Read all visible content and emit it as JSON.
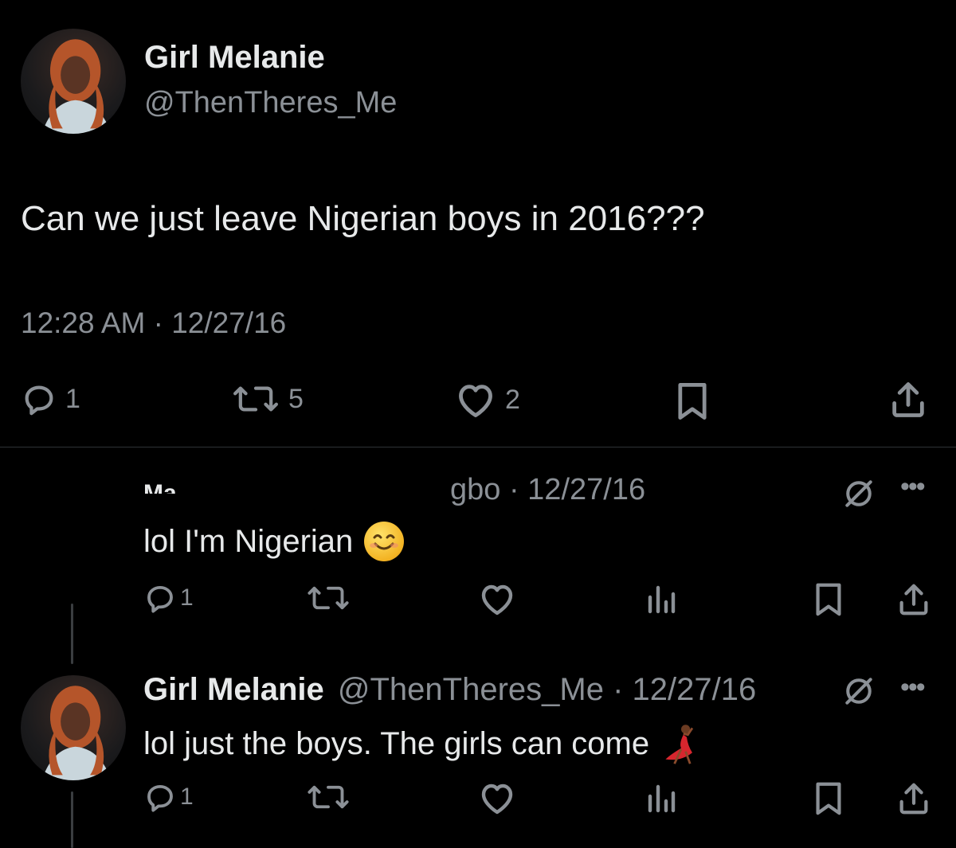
{
  "main_tweet": {
    "name": "Girl Melanie",
    "handle": "@ThenTheres_Me",
    "text": "Can we just leave Nigerian boys in 2016???",
    "time": "12:28 AM · 12/27/16",
    "stats": {
      "replies": "1",
      "retweets": "5",
      "likes": "2"
    }
  },
  "reply1": {
    "name_partial": "Ma",
    "meta_partial": "gbo · 12/27/16",
    "text": "lol I'm Nigerian",
    "emoji": "smiling-face-with-smiling-eyes",
    "replies": "1"
  },
  "reply2": {
    "name": "Girl Melanie",
    "handle_time": "@ThenTheres_Me · 12/27/16",
    "text": "lol just the boys. The girls can come",
    "emoji": "dancing-woman",
    "replies": "1"
  },
  "icons": [
    "reply-icon",
    "retweet-icon",
    "like-icon",
    "bookmark-icon",
    "share-icon",
    "analytics-icon",
    "more-icon",
    "mute-icon"
  ],
  "colors": {
    "background": "#000000",
    "text": "#e7e9ea",
    "secondary": "#8b9096",
    "divider": "#2f3336"
  }
}
